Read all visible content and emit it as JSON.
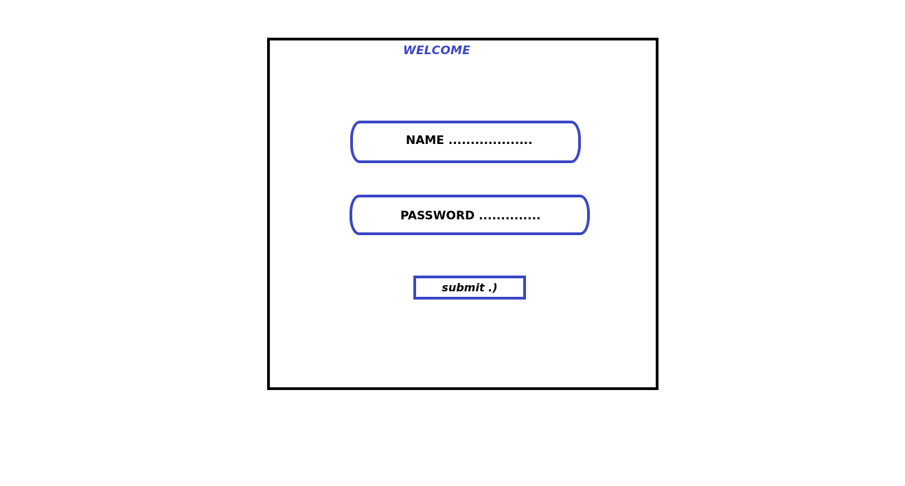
{
  "form": {
    "title": "WELCOME",
    "name_field": {
      "text": "NAME ..................."
    },
    "password_field": {
      "text": "PASSWORD .............."
    },
    "submit_label": "submit .)"
  },
  "colors": {
    "accent": "#3a46c8",
    "frame_border": "#000000",
    "background": "#ffffff",
    "text": "#000000"
  }
}
